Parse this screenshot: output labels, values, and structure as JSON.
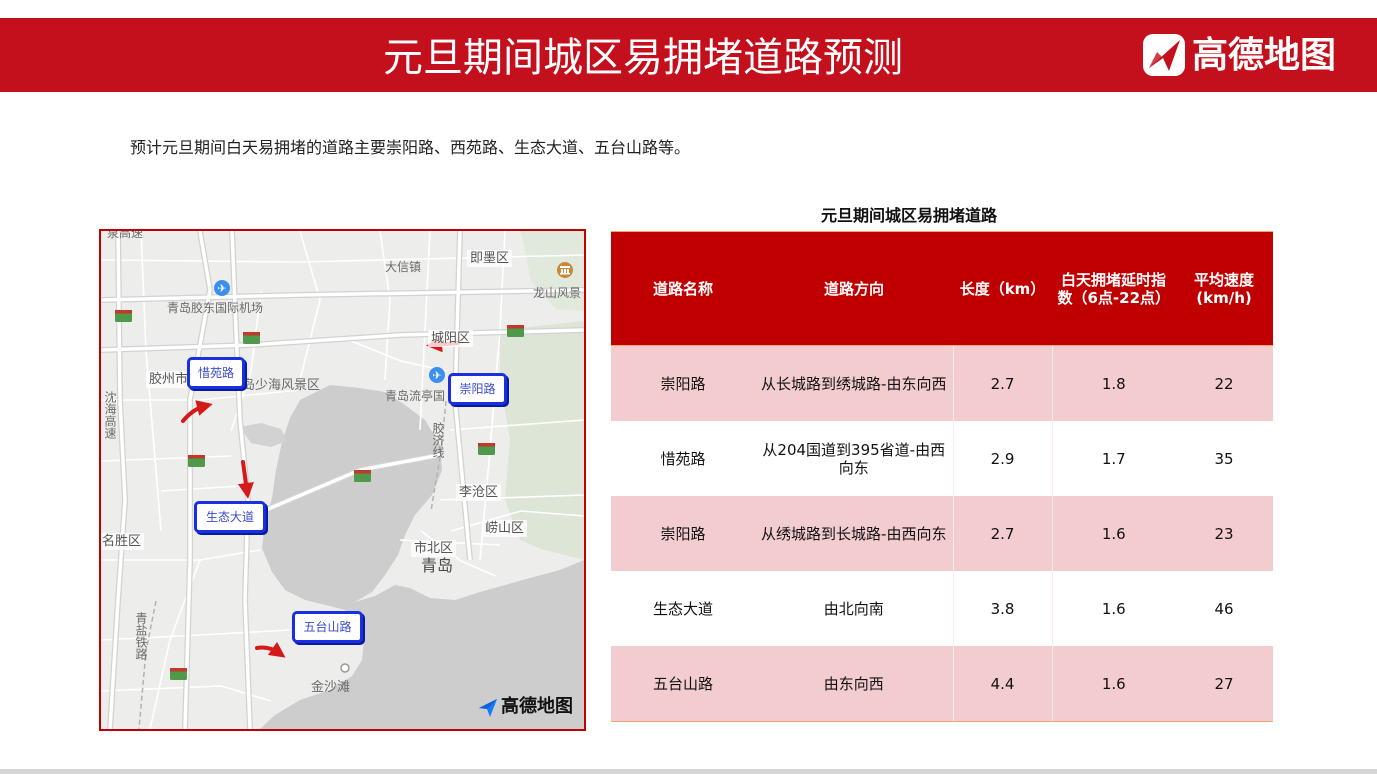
{
  "header": {
    "title": "元旦期间城区易拥堵道路预测",
    "logo_text": "高德地图"
  },
  "summary": "预计元旦期间白天易拥堵的道路主要崇阳路、西苑路、生态大道、五台山路等。",
  "map": {
    "place_labels": {
      "expressway_top": "泉高速",
      "daxin": "大信镇",
      "jimo": "即墨区",
      "longshan": "龙山风景",
      "airport_jiaodong": "青岛胶东国际机场",
      "chengyang": "城阳区",
      "jiaozhou": "胶州市",
      "shaohai": "岛少海风景区",
      "liuting": "青岛流亭国",
      "shenhai": "沈海高速",
      "jiaoji": "胶济线",
      "licang": "李沧区",
      "laoshan": "崂山区",
      "scenic": "名胜区",
      "shibei": "市北区",
      "qingdao": "青岛",
      "qingyan": "青盐铁路",
      "jinshatan": "金沙滩"
    },
    "road_tags": [
      "惜苑路",
      "崇阳路",
      "生态大道",
      "五台山路"
    ],
    "logo_text": "高德地图",
    "icons": {
      "airport": "airport-icon",
      "museum": "museum-icon",
      "logo": "amap-logo-icon",
      "arrow": "congestion-arrow-icon"
    }
  },
  "table": {
    "title": "元旦期间城区易拥堵道路",
    "columns": [
      "道路名称",
      "道路方向",
      "长度（km）",
      "白天拥堵延时指数（6点-22点）",
      "平均速度(km/h)"
    ],
    "rows": [
      {
        "road": "崇阳路",
        "direction": "从长城路到绣城路-由东向西",
        "length": "2.7",
        "delay_index": "1.8",
        "speed": "22"
      },
      {
        "road": "惜苑路",
        "direction": "从204国道到395省道-由西向东",
        "length": "2.9",
        "delay_index": "1.7",
        "speed": "35"
      },
      {
        "road": "崇阳路",
        "direction": "从绣城路到长城路-由西向东",
        "length": "2.7",
        "delay_index": "1.6",
        "speed": "23"
      },
      {
        "road": "生态大道",
        "direction": "由北向南",
        "length": "3.8",
        "delay_index": "1.6",
        "speed": "46"
      },
      {
        "road": "五台山路",
        "direction": "由东向西",
        "length": "4.4",
        "delay_index": "1.6",
        "speed": "27"
      }
    ]
  },
  "colors": {
    "banner": "#c4101c",
    "table_header": "#c00000",
    "row_highlight": "#f3cccf",
    "tag_border": "#1a2fe0",
    "arrow": "#d41a1a"
  }
}
